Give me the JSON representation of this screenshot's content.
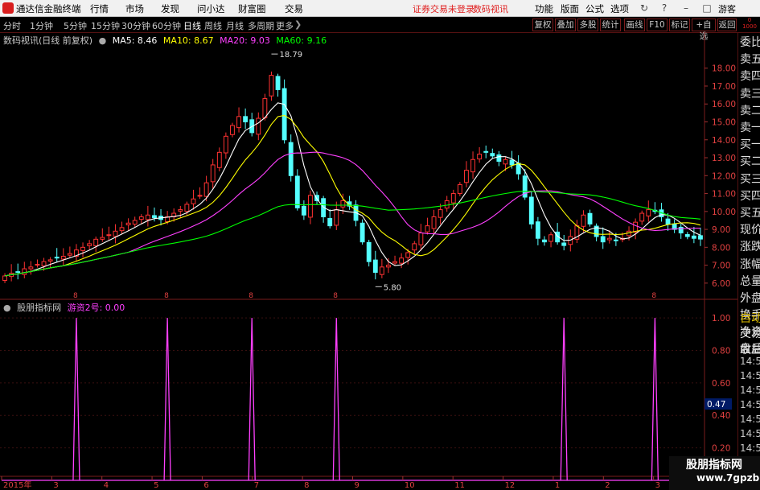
{
  "window": {
    "app_title": "通达信金融终端",
    "menu": [
      "行情",
      "市场",
      "发现",
      "问小达",
      "财富圈",
      "交易"
    ],
    "warning": "证券交易未登录",
    "stock_link": "数码视讯",
    "right_menu": [
      "功能",
      "版面",
      "公式",
      "选项"
    ],
    "user": "游客"
  },
  "periods": [
    "分时",
    "1分钟",
    "5分钟",
    "15分钟",
    "30分钟",
    "60分钟",
    "日线",
    "周线",
    "月线",
    "多周期",
    "更多"
  ],
  "active_period": "日线",
  "toolbar": [
    "复权",
    "叠加",
    "多股",
    "统计",
    "画线",
    "F10",
    "标记",
    "+自选",
    "返回"
  ],
  "legend": {
    "title": "数码视讯(日线 前复权)",
    "ma5": "MA5: 8.46",
    "ma10": "MA10: 8.67",
    "ma20": "MA20: 9.03",
    "ma60": "MA60: 9.16"
  },
  "indicator": {
    "name": "股朋指标网",
    "line": "游资2号: 0.00",
    "current_value": "0.47"
  },
  "annotations": {
    "high": "18.79",
    "low": "5.80"
  },
  "right_labels": {
    "top": "0\n1000",
    "upper": [
      "委比",
      "卖五",
      "卖四",
      "卖三",
      "卖二",
      "卖一",
      "买一",
      "买二",
      "买三",
      "买四",
      "买五",
      "现价",
      "涨跌",
      "涨幅",
      "总量",
      "外盘",
      "换手",
      "净资",
      "收益"
    ],
    "lower": [
      "自动",
      "交易",
      "盘后"
    ],
    "times": [
      "14:5",
      "14:5",
      "14:5",
      "14:5",
      "14:5",
      "14:5",
      "14:5",
      "14:5",
      "14:5",
      "14:5"
    ]
  },
  "watermark": {
    "line1": "股朋指标网",
    "line2": "www.7gpzb.com"
  },
  "colors": {
    "up": "#ff3232",
    "down": "#54ffff",
    "ma5": "#ffffff",
    "ma10": "#ffff00",
    "ma20": "#ff40ff",
    "ma60": "#00ff00",
    "signal": "#ff40ff"
  },
  "chart_data": [
    {
      "type": "candlestick",
      "title": "数码视讯(日线 前复权)",
      "x_ticks": [
        "2015年",
        "3",
        "4",
        "5",
        "6",
        "7",
        "8",
        "9",
        "10",
        "11",
        "12",
        "1",
        "2",
        "3",
        "4"
      ],
      "y_ticks": [
        "18.00",
        "17.00",
        "16.00",
        "15.00",
        "14.00",
        "13.00",
        "12.00",
        "11.00",
        "10.00",
        "9.00",
        "8.00",
        "7.00",
        "6.00"
      ],
      "ylim": [
        5.5,
        19.2
      ],
      "close": [
        6.4,
        6.55,
        6.6,
        6.8,
        6.9,
        7.05,
        7.2,
        7.3,
        7.4,
        7.5,
        7.65,
        7.85,
        8.0,
        8.2,
        8.45,
        8.55,
        8.7,
        8.9,
        9.1,
        9.35,
        9.5,
        9.7,
        9.8,
        9.65,
        9.55,
        9.7,
        9.9,
        10.1,
        10.4,
        10.7,
        10.9,
        11.6,
        12.6,
        13.3,
        14.2,
        14.8,
        15.3,
        15.0,
        14.4,
        15.2,
        16.3,
        17.6,
        16.8,
        14.0,
        12.0,
        10.2,
        9.8,
        10.9,
        10.6,
        9.7,
        9.2,
        10.1,
        10.6,
        10.3,
        9.5,
        8.3,
        7.2,
        6.6,
        6.9,
        7.0,
        7.2,
        7.4,
        7.7,
        8.2,
        8.8,
        9.2,
        9.7,
        10.1,
        10.6,
        11.0,
        11.5,
        12.3,
        12.9,
        13.2,
        13.3,
        13.1,
        12.8,
        12.9,
        12.6,
        12.1,
        10.8,
        9.3,
        8.5,
        8.3,
        8.7,
        8.3,
        8.1,
        8.6,
        9.2,
        9.8,
        9.3,
        8.6,
        8.3,
        8.5,
        8.4,
        8.5,
        8.9,
        9.4,
        9.9,
        10.1,
        10.0,
        9.7,
        9.3,
        9.0,
        8.8,
        8.6,
        8.5,
        8.46
      ],
      "ma_lines": [
        "MA5",
        "MA10",
        "MA20",
        "MA60"
      ],
      "annotations": [
        "18.79",
        "5.80"
      ]
    },
    {
      "type": "line",
      "series": [
        {
          "name": "游资2号",
          "x_index": [
            11,
            25,
            38,
            51,
            86,
            100
          ],
          "values": [
            1,
            1,
            1,
            1,
            1,
            1
          ]
        }
      ],
      "y_ticks": [
        "1.00",
        "0.80",
        "0.60",
        "0.40",
        "0.20"
      ],
      "ylim": [
        0,
        1.05
      ]
    }
  ]
}
